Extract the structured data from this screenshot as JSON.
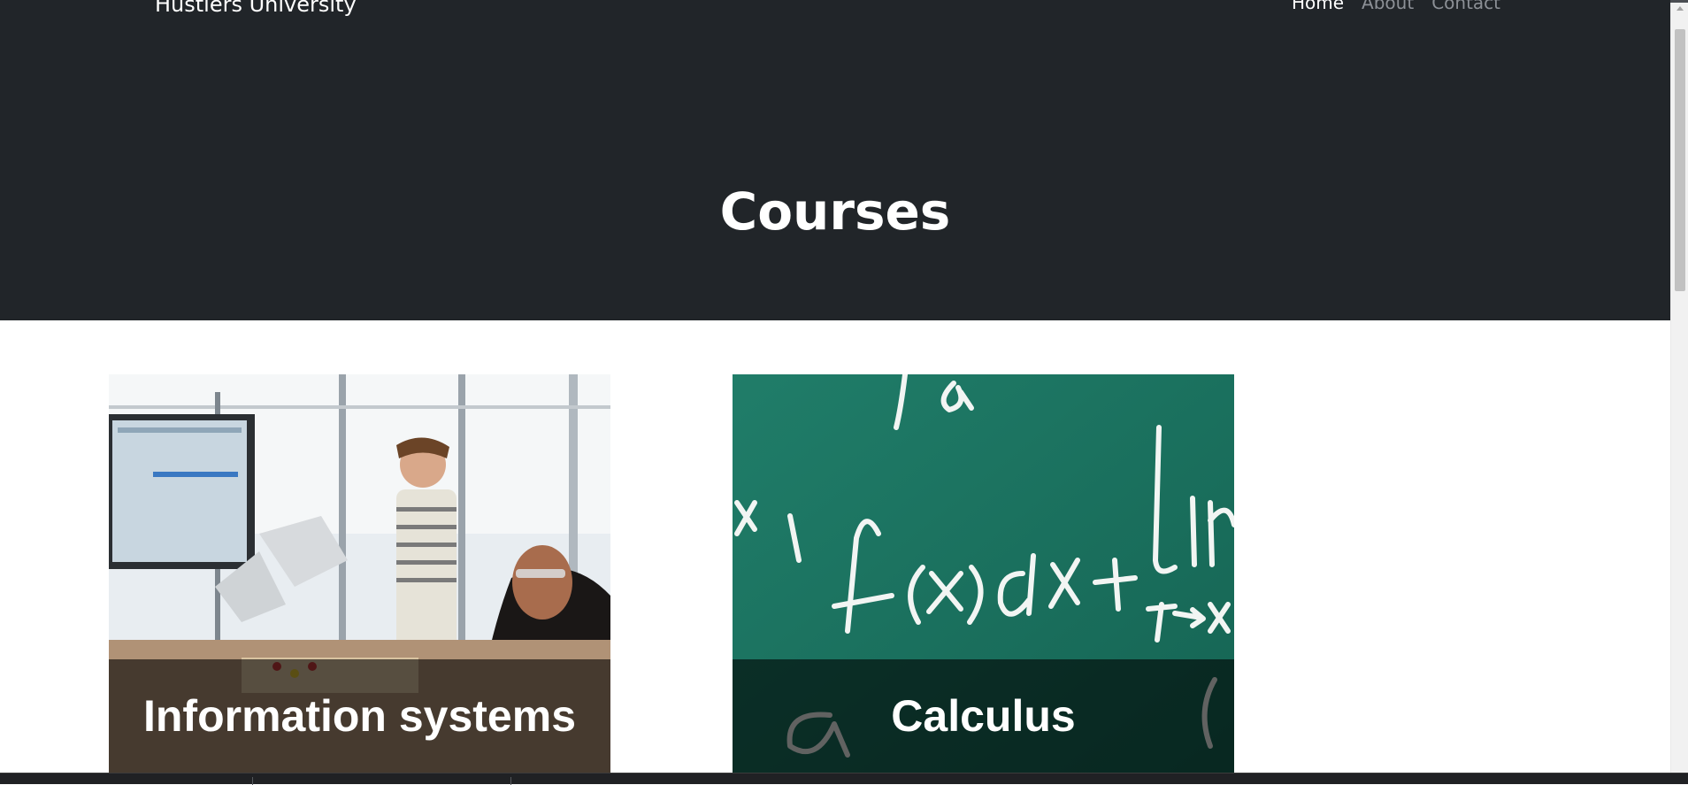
{
  "header": {
    "brand": "Hustlers University",
    "nav": [
      {
        "label": "Home",
        "active": true
      },
      {
        "label": "About",
        "active": false
      },
      {
        "label": "Contact",
        "active": false
      }
    ]
  },
  "hero": {
    "title": "Courses"
  },
  "courses": [
    {
      "title": "Information systems",
      "image": "students-robotics-lab-photo"
    },
    {
      "title": "Calculus",
      "image": "chalkboard-math-formula-photo"
    }
  ],
  "colors": {
    "hero_bg": "#212529",
    "nav_active": "#ffffff",
    "nav_muted": "#8c9096",
    "caption_overlay": "rgba(0,0,0,0.6)",
    "chalkboard": "#1f7a66"
  }
}
